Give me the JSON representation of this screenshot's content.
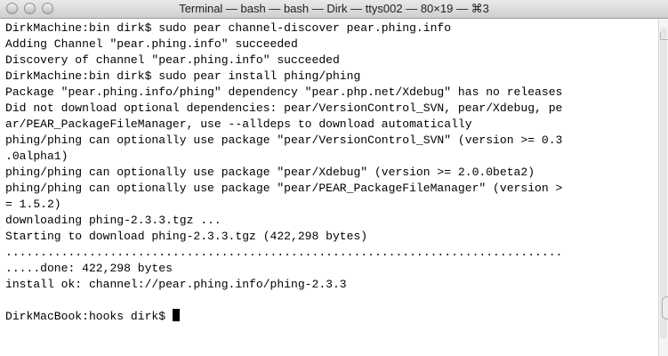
{
  "window": {
    "title": "Terminal — bash — bash — Dirk — ttys002 — 80×19 — ⌘3"
  },
  "icons": {
    "close": "close-icon",
    "minimize": "minimize-icon",
    "zoom": "zoom-icon"
  },
  "terminal": {
    "lines": [
      "DirkMachine:bin dirk$ sudo pear channel-discover pear.phing.info",
      "Adding Channel \"pear.phing.info\" succeeded",
      "Discovery of channel \"pear.phing.info\" succeeded",
      "DirkMachine:bin dirk$ sudo pear install phing/phing",
      "Package \"pear.phing.info/phing\" dependency \"pear.php.net/Xdebug\" has no releases",
      "Did not download optional dependencies: pear/VersionControl_SVN, pear/Xdebug, pe",
      "ar/PEAR_PackageFileManager, use --alldeps to download automatically",
      "phing/phing can optionally use package \"pear/VersionControl_SVN\" (version >= 0.3",
      ".0alpha1)",
      "phing/phing can optionally use package \"pear/Xdebug\" (version >= 2.0.0beta2)",
      "phing/phing can optionally use package \"pear/PEAR_PackageFileManager\" (version >",
      "= 1.5.2)",
      "downloading phing-2.3.3.tgz ...",
      "Starting to download phing-2.3.3.tgz (422,298 bytes)",
      "................................................................................",
      ".....done: 422,298 bytes",
      "install ok: channel://pear.phing.info/phing-2.3.3",
      ""
    ],
    "prompt": "DirkMacBook:hooks dirk$ "
  }
}
